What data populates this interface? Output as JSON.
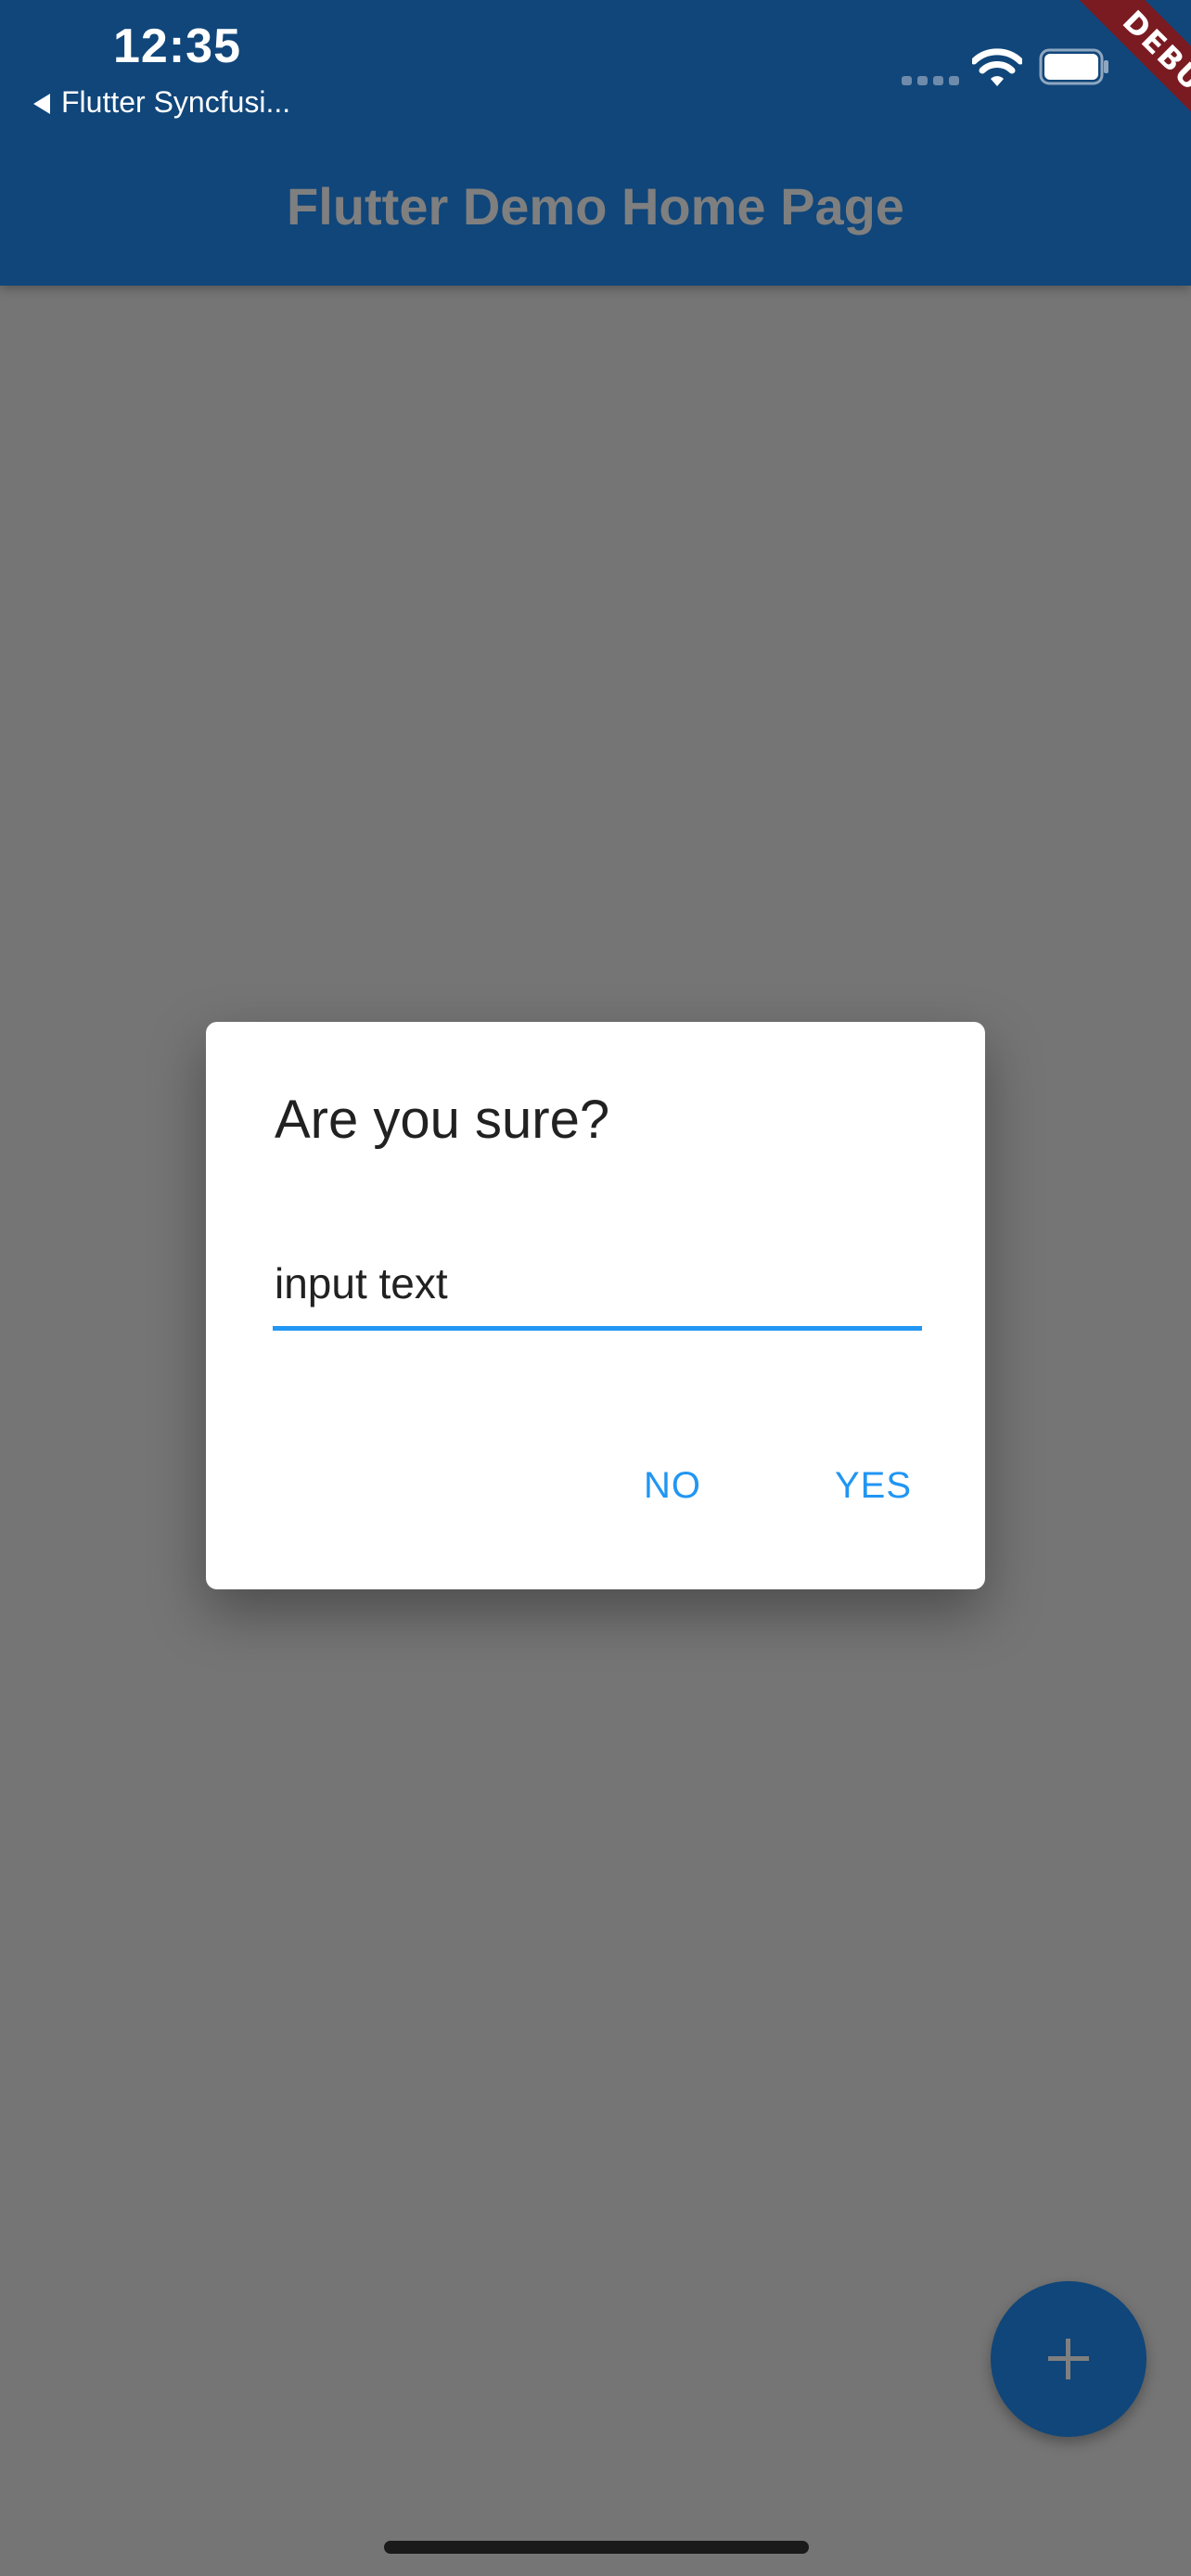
{
  "status_bar": {
    "time": "12:35",
    "back_app_label": "Flutter Syncfusi...",
    "icons": [
      "signal-dots-icon",
      "wifi-icon",
      "battery-icon"
    ]
  },
  "debug_banner": {
    "label": "DEBUG",
    "color": "#7a1b22"
  },
  "app_bar": {
    "title": "Flutter Demo Home Page",
    "background": "#10467a"
  },
  "dialog": {
    "title": "Are you sure?",
    "input_value": "input text",
    "buttons": {
      "no_label": "NO",
      "yes_label": "YES"
    },
    "accent": "#2196f3"
  },
  "fab": {
    "icon": "plus-icon"
  },
  "scrim_color": "#757575"
}
